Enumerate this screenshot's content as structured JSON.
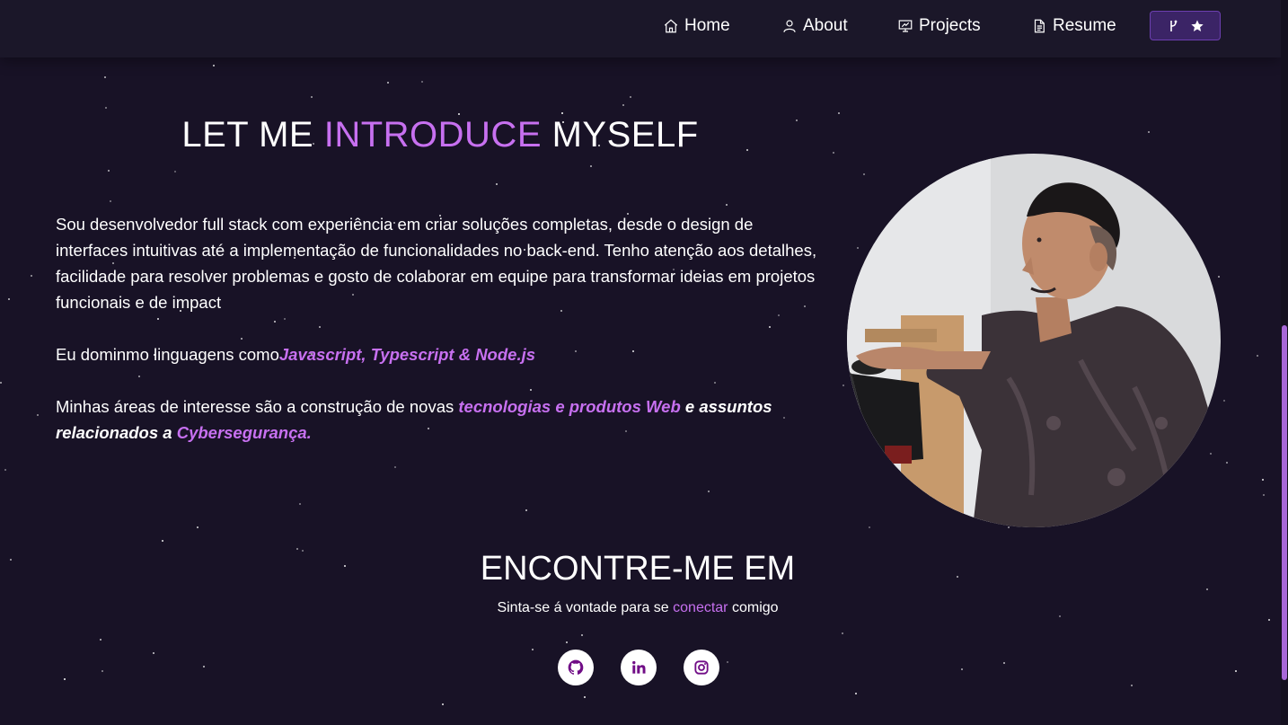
{
  "nav": {
    "home_label": "Home",
    "about_label": "About",
    "projects_label": "Projects",
    "resume_label": "Resume"
  },
  "intro": {
    "title_part1": "LET ME ",
    "title_highlight": "INTRODUCE",
    "title_part2": " MYSELF",
    "para1": "Sou desenvolvedor full stack com experiência em criar soluções completas, desde o design de interfaces intuitivas até a implementação de funcionalidades no back-end. Tenho atenção aos detalhes, facilidade para resolver problemas e gosto de colaborar em equipe para transformar ideias em projetos funcionais e de impact",
    "para2_text": "Eu dominmo linguagens como",
    "para2_highlight": "Javascript, Typescript & Node.js",
    "para3_text": "Minhas áreas de interesse são a construção de novas ",
    "para3_highlight1": "tecnologias e produtos Web",
    "para3_mid": " e assuntos relacionados a ",
    "para3_highlight2": "Cybersegurança."
  },
  "find": {
    "title": "ENCONTRE-ME EM",
    "sub_text": "Sinta-se á vontade para se ",
    "sub_highlight": "conectar",
    "sub_end": " comigo"
  },
  "icons": {
    "home": "home-icon",
    "about": "user-icon",
    "projects": "presentation-icon",
    "resume": "document-icon",
    "fork": "git-fork-icon",
    "star": "star-icon",
    "github": "github-icon",
    "linkedin": "linkedin-icon",
    "instagram": "instagram-icon"
  },
  "colors": {
    "background": "#181226",
    "navbar": "#1b1729",
    "accent": "#c770f0",
    "button": "#3b2466",
    "social_icon": "#700c86"
  }
}
